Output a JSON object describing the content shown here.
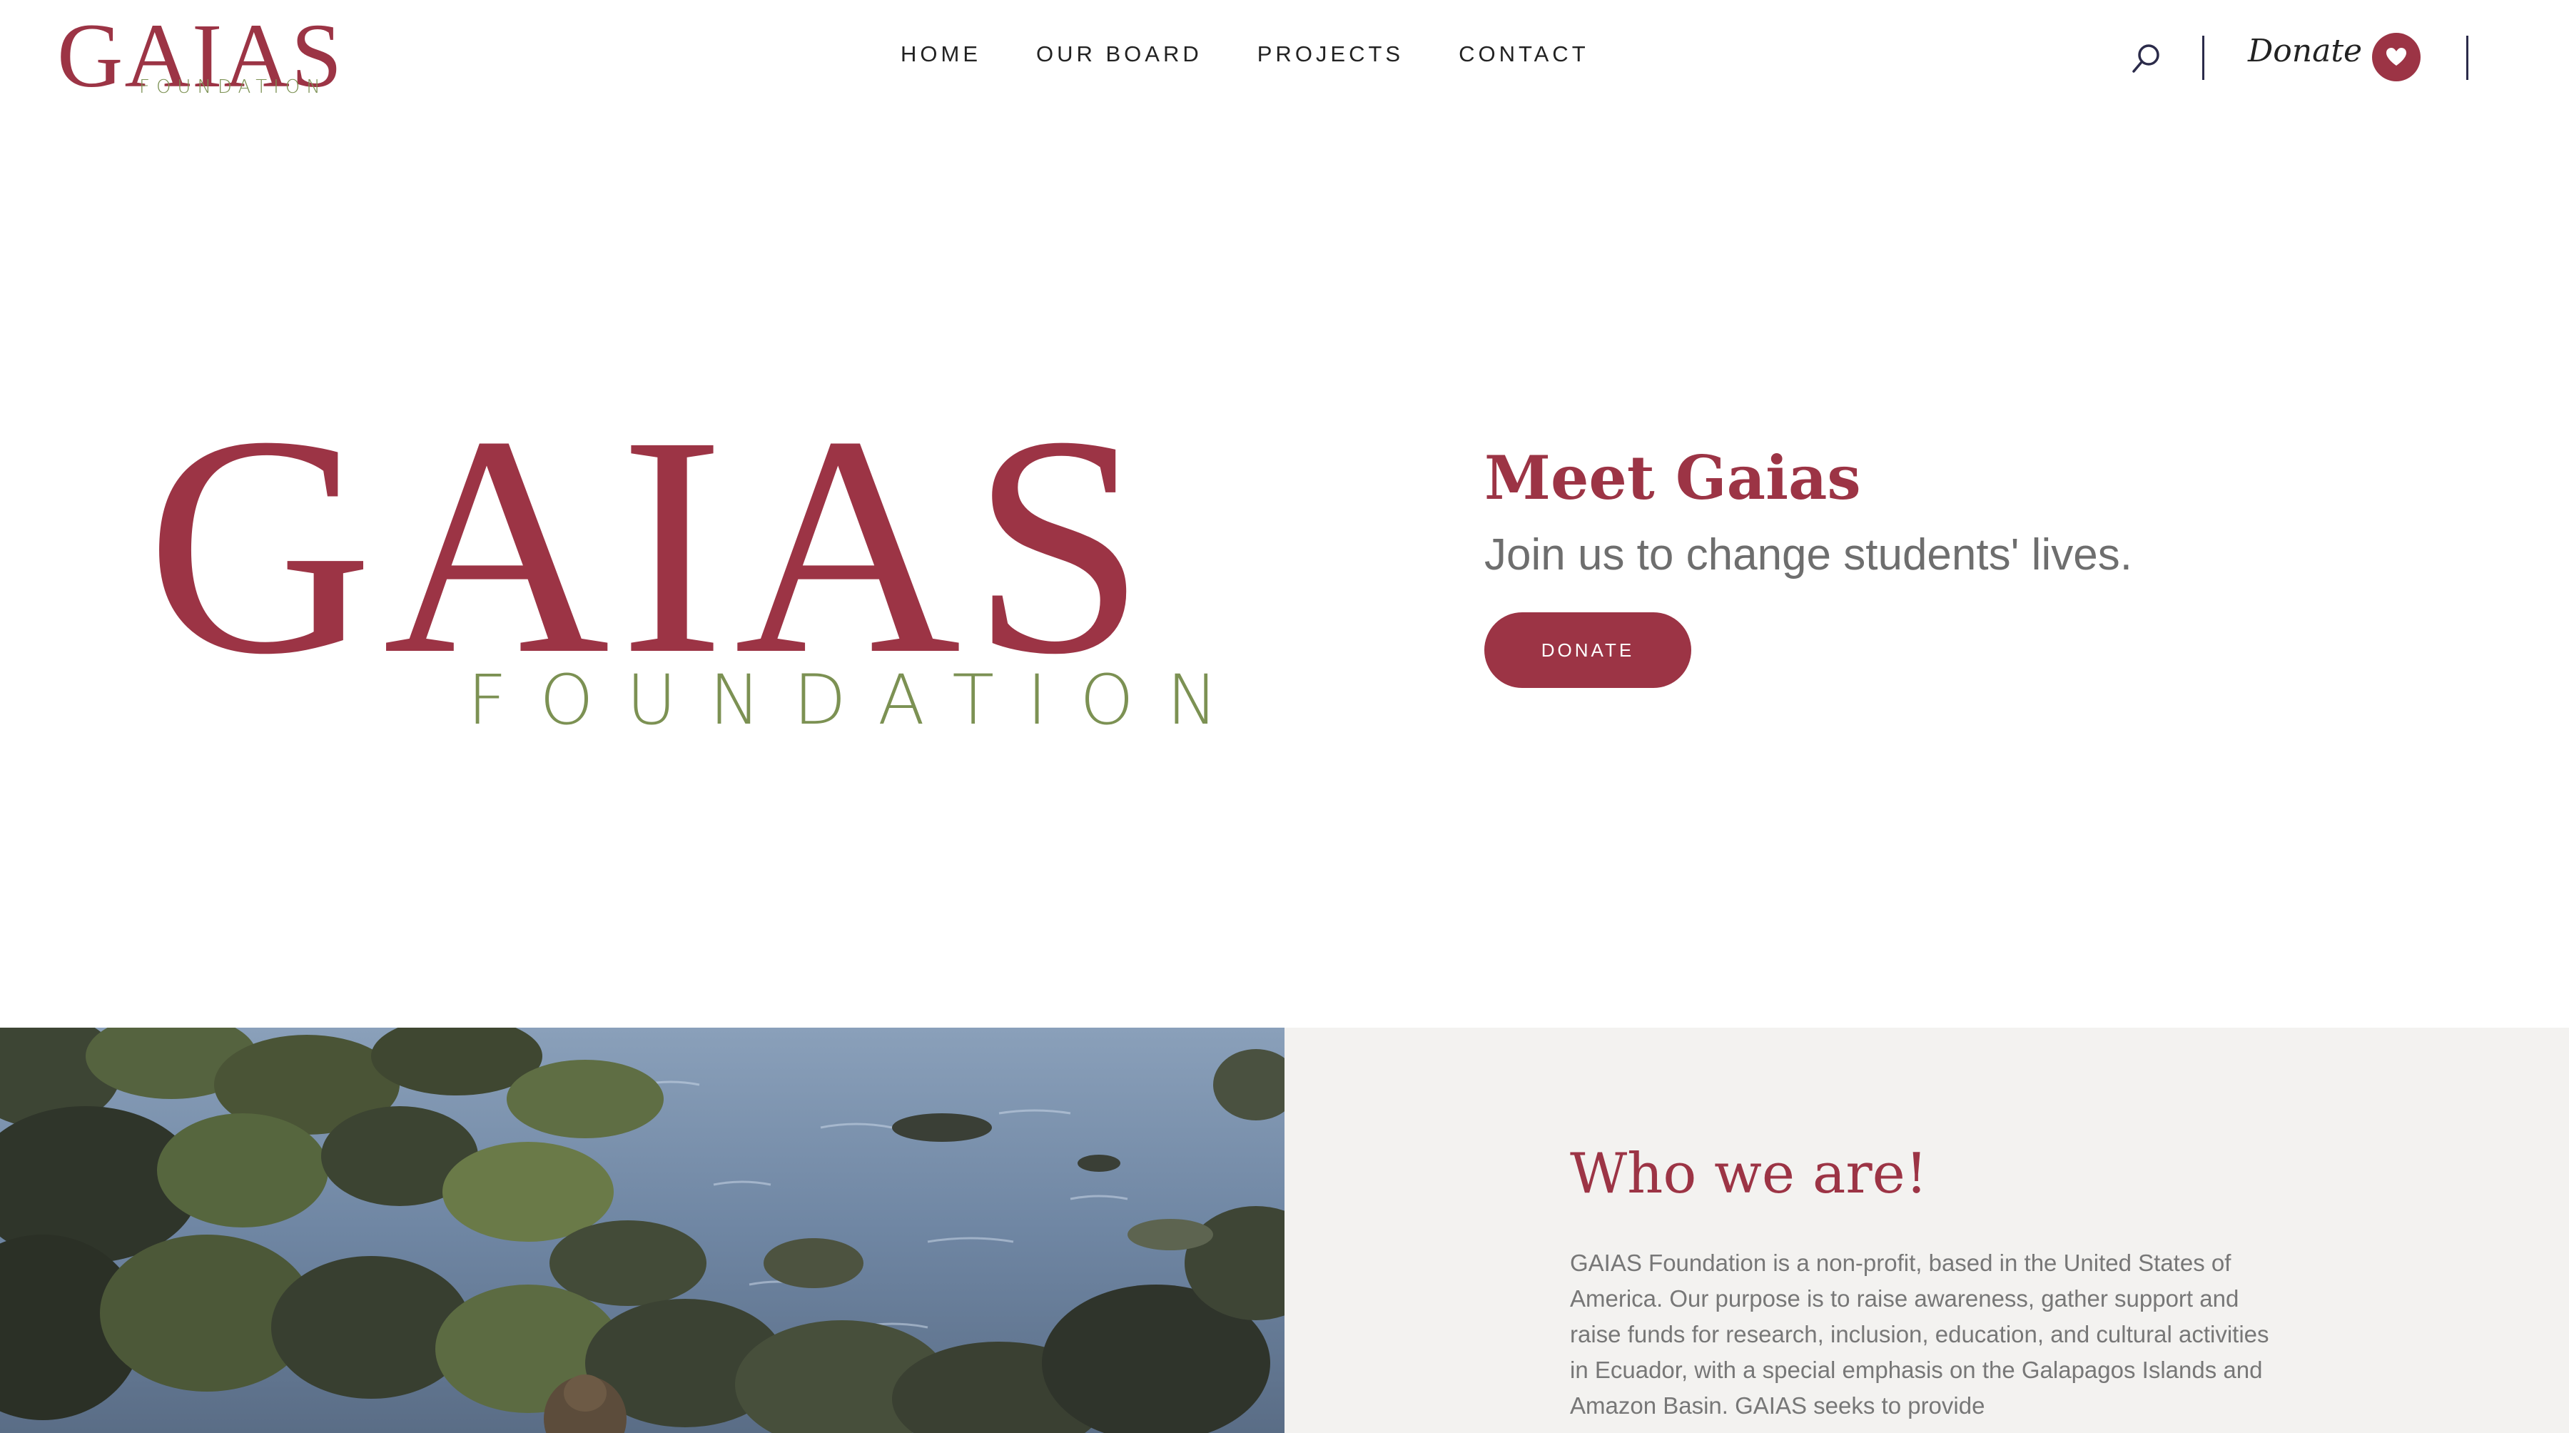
{
  "header": {
    "logo": {
      "word": "GAIAS",
      "sub": "FOUNDATION"
    },
    "nav": [
      "HOME",
      "OUR BOARD",
      "PROJECTS",
      "CONTACT"
    ],
    "donate_link": "Donate"
  },
  "hero": {
    "logo": {
      "word": "GAIAS",
      "sub": "FOUNDATION"
    },
    "title": "Meet Gaias",
    "tagline": "Join us to change students' lives.",
    "donate_button": "DONATE"
  },
  "about": {
    "title": "Who we are!",
    "text": "GAIAS Foundation is a non-profit, based in the United States of America. Our purpose is to raise awareness, gather support and raise funds for research, inclusion, education, and cultural activities in Ecuador, with a special emphasis on the Galapagos Islands and Amazon Basin. GAIAS seeks to provide"
  },
  "colors": {
    "brand": "#9c3445",
    "accent": "#7c9153",
    "panel": "#f3f2f0"
  },
  "icons": {
    "search": "search-icon",
    "heart": "heart-icon"
  }
}
